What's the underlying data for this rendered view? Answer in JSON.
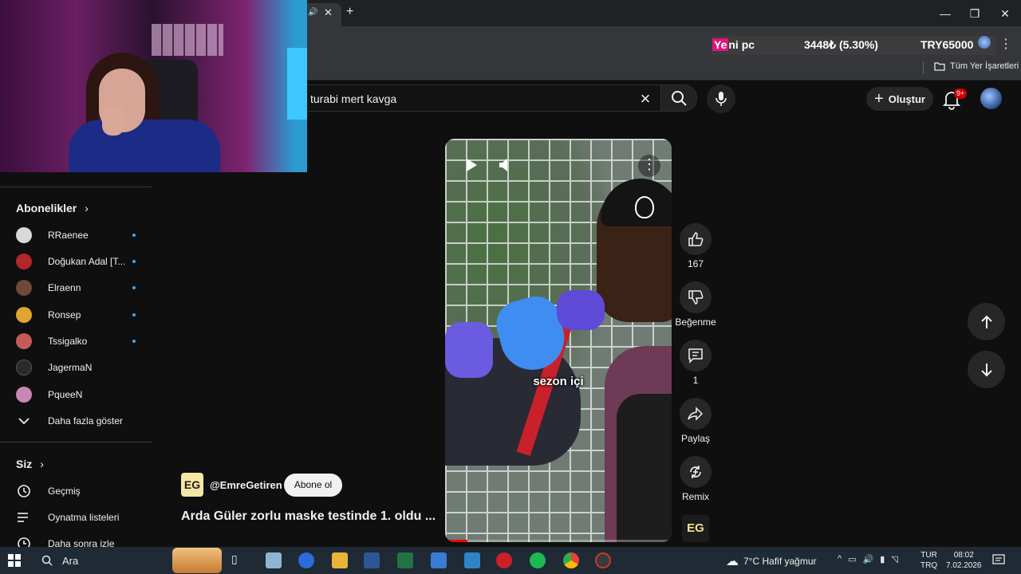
{
  "browser": {
    "bookmarks_all_label": "Tüm Yer İşaretleri",
    "win_controls": [
      "—",
      "❐",
      "✕"
    ]
  },
  "ticker": {
    "name_highlight": "Ye",
    "name_rest": "ni pc",
    "price": "3448₺ (5.30%)",
    "goal": "TRY65000"
  },
  "header": {
    "search_value": "turabi mert kavga",
    "create_label": "Oluştur",
    "notif_badge": "9+"
  },
  "sidebar": {
    "subscriptions_title": "Abonelikler",
    "subscriptions": [
      {
        "name": "RRaenee",
        "color": "#d9d9d9",
        "new": true
      },
      {
        "name": "Doğukan Adal [T...",
        "color": "#b3262a",
        "new": true
      },
      {
        "name": "Elraenn",
        "color": "#6b4a3a",
        "new": true
      },
      {
        "name": "Ronsep",
        "color": "#e0a530",
        "new": true
      },
      {
        "name": "Tssigalko",
        "color": "#c45a5a",
        "new": true
      },
      {
        "name": "JagermaN",
        "color": "#2a2a2a",
        "new": false
      },
      {
        "name": "PqueeN",
        "color": "#c987b5",
        "new": false
      }
    ],
    "show_more": "Daha fazla göster",
    "you_title": "Siz",
    "you_items": [
      "Geçmiş",
      "Oynatma listeleri",
      "Daha sonra izle"
    ]
  },
  "video": {
    "caption": "sezon içi",
    "progress": 0.1,
    "channel_logo": "EG",
    "channel_handle": "@EmreGetiren",
    "subscribe_label": "Abone ol",
    "title": "Arda Güler zorlu maske testinde 1. oldu ..."
  },
  "actions": {
    "likes": "167",
    "dislike_label": "Beğenme",
    "comments": "1",
    "share_label": "Paylaş",
    "remix_label": "Remix",
    "eg_thumb": "EG"
  },
  "taskbar": {
    "search_placeholder": "Ara",
    "weather": "7°C  Hafif yağmur",
    "lang_top": "TUR",
    "lang_bottom": "TRQ",
    "time": "08:02",
    "date": "7.02.2026",
    "app_colors": [
      "#8fb5d4",
      "#2b6cd6",
      "#e8b43a",
      "#2b5797",
      "#217346",
      "#3a7bd5",
      "#2f84c8",
      "#cc1f27",
      "#1db954",
      "#4285f4",
      "#c23a2f"
    ]
  }
}
